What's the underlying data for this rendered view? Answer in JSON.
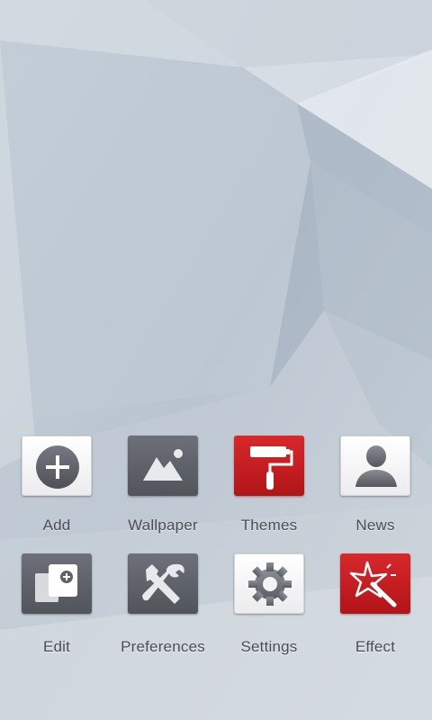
{
  "home_screen": {
    "apps": [
      {
        "label": "Add",
        "icon": "add-icon",
        "style": "white"
      },
      {
        "label": "Wallpaper",
        "icon": "wallpaper-icon",
        "style": "dark"
      },
      {
        "label": "Themes",
        "icon": "paint-roller-icon",
        "style": "red"
      },
      {
        "label": "News",
        "icon": "person-icon",
        "style": "white"
      },
      {
        "label": "Edit",
        "icon": "edit-icon",
        "style": "dark"
      },
      {
        "label": "Preferences",
        "icon": "tools-icon",
        "style": "dark"
      },
      {
        "label": "Settings",
        "icon": "gear-icon",
        "style": "white"
      },
      {
        "label": "Effect",
        "icon": "magic-wand-icon",
        "style": "red"
      }
    ]
  },
  "colors": {
    "accent_red": "#c41d20",
    "tile_dark": "#5f616a",
    "tile_white": "#f6f6f7",
    "label_text": "#4b4d55"
  }
}
